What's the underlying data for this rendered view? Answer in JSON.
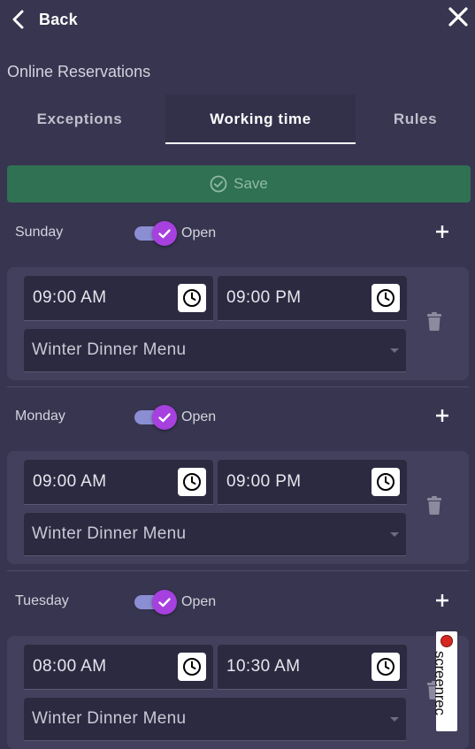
{
  "header": {
    "back_label": "Back"
  },
  "section_title": "Online Reservations",
  "tabs": [
    {
      "label": "Exceptions",
      "active": false
    },
    {
      "label": "Working time",
      "active": true
    },
    {
      "label": "Rules",
      "active": false
    }
  ],
  "save_label": "Save",
  "days": [
    {
      "name": "Sunday",
      "open_label": "Open",
      "open": true,
      "start": "09:00 AM",
      "end": "09:00 PM",
      "menu": "Winter Dinner Menu"
    },
    {
      "name": "Monday",
      "open_label": "Open",
      "open": true,
      "start": "09:00 AM",
      "end": "09:00 PM",
      "menu": "Winter Dinner Menu"
    },
    {
      "name": "Tuesday",
      "open_label": "Open",
      "open": true,
      "start": "08:00 AM",
      "end": "10:30 AM",
      "menu": "Winter Dinner Menu"
    }
  ],
  "watermark": "screenrec",
  "colors": {
    "background": "#37354f",
    "save": "#2f7152",
    "toggle_knob": "#a640df",
    "toggle_track": "#8c8ed4"
  }
}
